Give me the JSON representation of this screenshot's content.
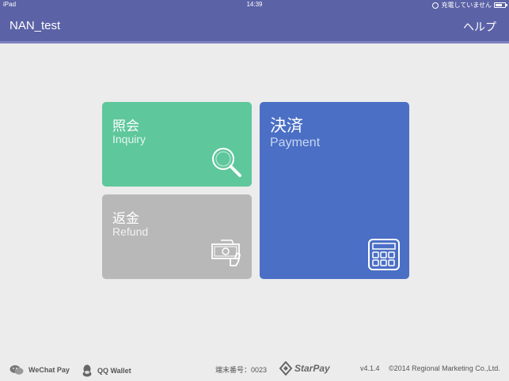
{
  "status_bar": {
    "device": "iPad",
    "time": "14:39",
    "charging_text": "充電していません"
  },
  "navbar": {
    "title": "NAN_test",
    "help_label": "ヘルプ"
  },
  "tiles": {
    "inquiry": {
      "jp": "照会",
      "en": "Inquiry",
      "color": "#5ec79c",
      "icon": "magnifier-icon"
    },
    "refund": {
      "jp": "返金",
      "en": "Refund",
      "color": "#b8b8b8",
      "icon": "cash-hand-icon"
    },
    "payment": {
      "jp": "決済",
      "en": "Payment",
      "color": "#4a6fc5",
      "icon": "calculator-icon"
    }
  },
  "footer": {
    "wechat": "WeChat Pay",
    "qq": "QQ Wallet",
    "terminal": "端末番号：0023",
    "brand": "StarPay",
    "version": "v4.1.4",
    "copyright": "©2014 Regional Marketing Co.,Ltd."
  }
}
